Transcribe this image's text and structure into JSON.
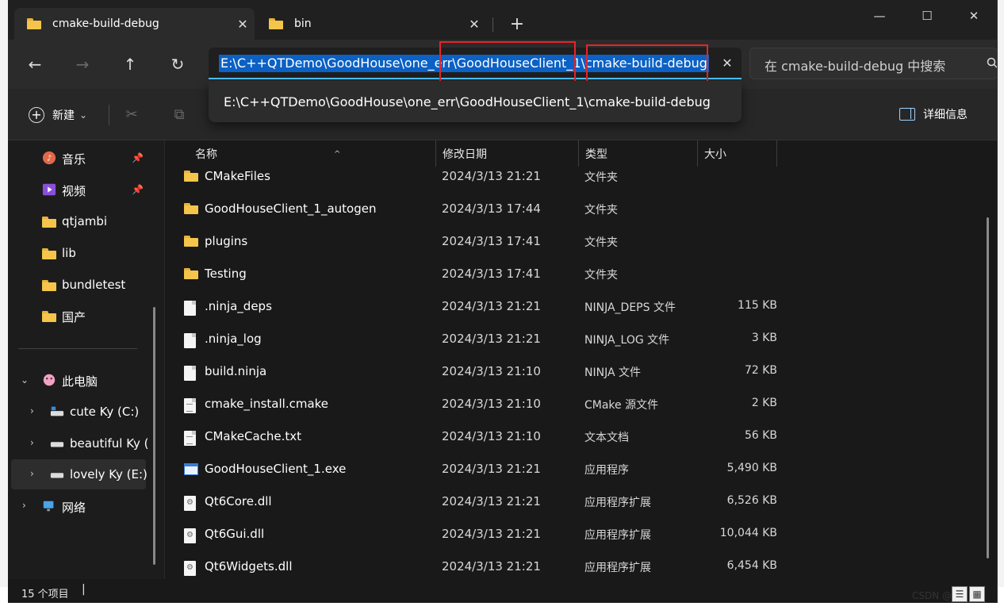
{
  "tabs": [
    {
      "title": "cmake-build-debug",
      "close": "✕"
    },
    {
      "title": "bin",
      "close": "✕"
    }
  ],
  "new_tab": "+",
  "window_controls": {
    "minimize": "—",
    "maximize": "☐",
    "close": "✕"
  },
  "nav": {
    "back": "←",
    "forward": "→",
    "up": "↑",
    "refresh": "↻"
  },
  "address": {
    "path": "E:\\C++QTDemo\\GoodHouse\\one_err\\GoodHouseClient_1\\cmake-build-debug",
    "clear": "✕",
    "suggestion": "E:\\C++QTDemo\\GoodHouse\\one_err\\GoodHouseClient_1\\cmake-build-debug"
  },
  "search": {
    "placeholder": "在 cmake-build-debug 中搜索"
  },
  "commands": {
    "new_label": "新建",
    "new_caret": "⌄",
    "details_label": "详细信息"
  },
  "sidebar": {
    "quick": [
      {
        "label": "音乐",
        "pinned": true
      },
      {
        "label": "视频",
        "pinned": true
      },
      {
        "label": "qtjambi"
      },
      {
        "label": "lib"
      },
      {
        "label": "bundletest"
      },
      {
        "label": "国产"
      }
    ],
    "this_pc": "此电脑",
    "drives": [
      "cute Ky (C:)",
      "beautiful Ky (",
      "lovely Ky (E:)"
    ],
    "network": "网络"
  },
  "columns": {
    "name": "名称",
    "modified": "修改日期",
    "type": "类型",
    "size": "大小"
  },
  "files": [
    {
      "name": "CMakeFiles",
      "date": "2024/3/13 21:21",
      "type": "文件夹",
      "size": "",
      "kind": "folder"
    },
    {
      "name": "GoodHouseClient_1_autogen",
      "date": "2024/3/13 17:44",
      "type": "文件夹",
      "size": "",
      "kind": "folder"
    },
    {
      "name": "plugins",
      "date": "2024/3/13 17:41",
      "type": "文件夹",
      "size": "",
      "kind": "folder"
    },
    {
      "name": "Testing",
      "date": "2024/3/13 17:41",
      "type": "文件夹",
      "size": "",
      "kind": "folder"
    },
    {
      "name": ".ninja_deps",
      "date": "2024/3/13 21:21",
      "type": "NINJA_DEPS 文件",
      "size": "115 KB",
      "kind": "file"
    },
    {
      "name": ".ninja_log",
      "date": "2024/3/13 21:21",
      "type": "NINJA_LOG 文件",
      "size": "3 KB",
      "kind": "file"
    },
    {
      "name": "build.ninja",
      "date": "2024/3/13 21:10",
      "type": "NINJA 文件",
      "size": "72 KB",
      "kind": "file"
    },
    {
      "name": "cmake_install.cmake",
      "date": "2024/3/13 21:10",
      "type": "CMake 源文件",
      "size": "2 KB",
      "kind": "txt"
    },
    {
      "name": "CMakeCache.txt",
      "date": "2024/3/13 21:10",
      "type": "文本文档",
      "size": "56 KB",
      "kind": "txt"
    },
    {
      "name": "GoodHouseClient_1.exe",
      "date": "2024/3/13 21:21",
      "type": "应用程序",
      "size": "5,490 KB",
      "kind": "exe"
    },
    {
      "name": "Qt6Core.dll",
      "date": "2024/3/13 21:21",
      "type": "应用程序扩展",
      "size": "6,526 KB",
      "kind": "dll"
    },
    {
      "name": "Qt6Gui.dll",
      "date": "2024/3/13 21:21",
      "type": "应用程序扩展",
      "size": "10,044 KB",
      "kind": "dll"
    },
    {
      "name": "Qt6Widgets.dll",
      "date": "2024/3/13 21:21",
      "type": "应用程序扩展",
      "size": "6,454 KB",
      "kind": "dll"
    }
  ],
  "status": {
    "count": "15 个项目",
    "caret": "|"
  },
  "watermark": "CSDN @",
  "colors": {
    "accent": "#4cc2ff",
    "selection": "#0b61c4",
    "annotation": "#e4252a",
    "folder": "#f4c54a"
  }
}
